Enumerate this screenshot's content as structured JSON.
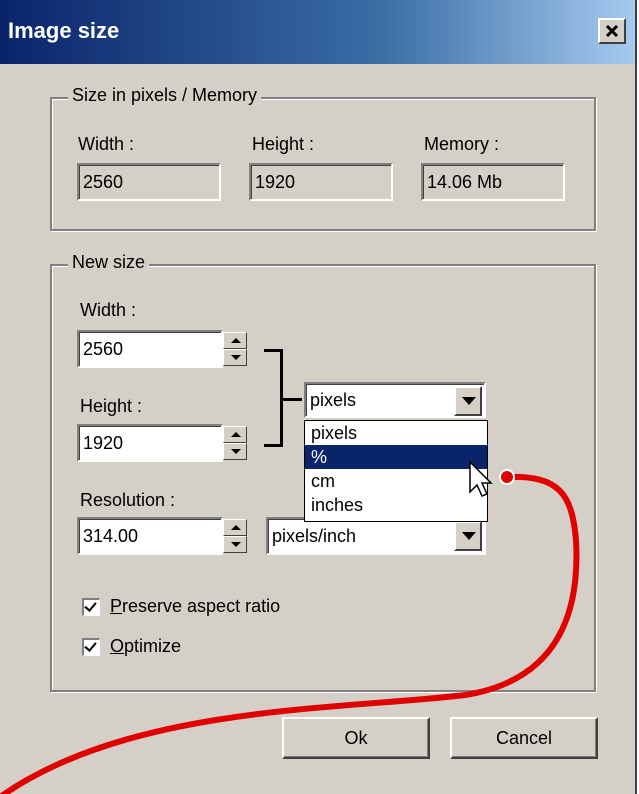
{
  "window": {
    "title": "Image size",
    "close_symbol": "×"
  },
  "size_group": {
    "legend": "Size in pixels / Memory",
    "width_label": "Width :",
    "height_label": "Height :",
    "memory_label": "Memory :",
    "width_value": "2560",
    "height_value": "1920",
    "memory_value": "14.06 Mb"
  },
  "new_size_group": {
    "legend": "New size",
    "width_label": "Width :",
    "width_value": "2560",
    "height_label": "Height :",
    "height_value": "1920",
    "unit_selected": "pixels",
    "unit_options": [
      "pixels",
      "%",
      "cm",
      "inches"
    ],
    "unit_highlighted": "%",
    "resolution_label": "Resolution :",
    "resolution_value": "314.00",
    "resolution_unit": "pixels/inch"
  },
  "options": {
    "preserve_aspect": {
      "label_prefix": "P",
      "label_rest": "reserve aspect ratio",
      "checked": true
    },
    "optimize": {
      "label_prefix": "O",
      "label_rest": "ptimize",
      "checked": true
    }
  },
  "buttons": {
    "ok": "Ok",
    "cancel": "Cancel"
  },
  "annotation": {
    "color": "#e00000"
  },
  "icons": {
    "close": "close-icon",
    "cursor": "mouse-pointer-icon"
  }
}
